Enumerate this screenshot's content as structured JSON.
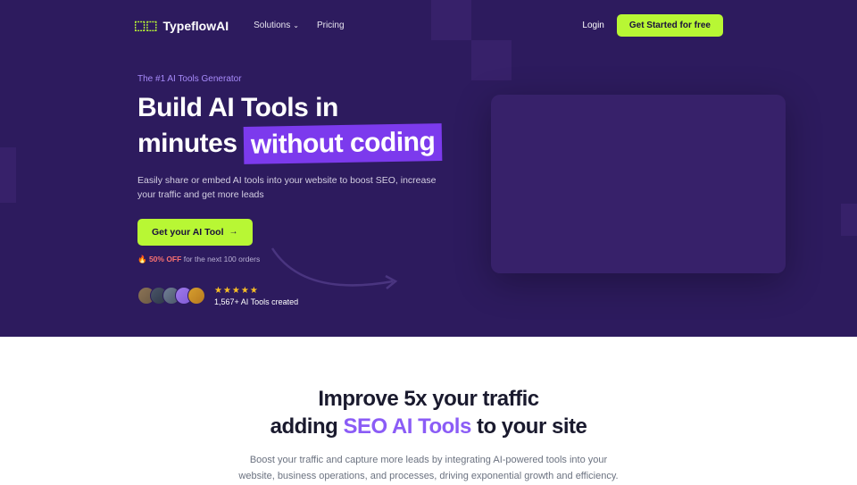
{
  "brand": "TypeflowAI",
  "nav": {
    "solutions": "Solutions",
    "pricing": "Pricing",
    "login": "Login",
    "cta": "Get Started for free"
  },
  "hero": {
    "eyebrow": "The #1 AI Tools Generator",
    "title_line1": "Build AI Tools in",
    "title_line2a": "minutes",
    "title_highlight": "without coding",
    "subhead": "Easily share or embed AI tools into your website to boost SEO, increase your traffic and get more leads",
    "cta": "Get your AI Tool",
    "promo_badge": "🔥 50% OFF",
    "promo_text": "for the next 100 orders",
    "social_count": "1,567+ AI Tools created"
  },
  "section2": {
    "title_line1": "Improve 5x your traffic",
    "title_line2a": "adding ",
    "title_em": "SEO AI Tools",
    "title_line2b": " to your site",
    "sub": "Boost your traffic and capture more leads by integrating AI-powered tools into your website, business operations, and processes, driving exponential growth and efficiency."
  }
}
